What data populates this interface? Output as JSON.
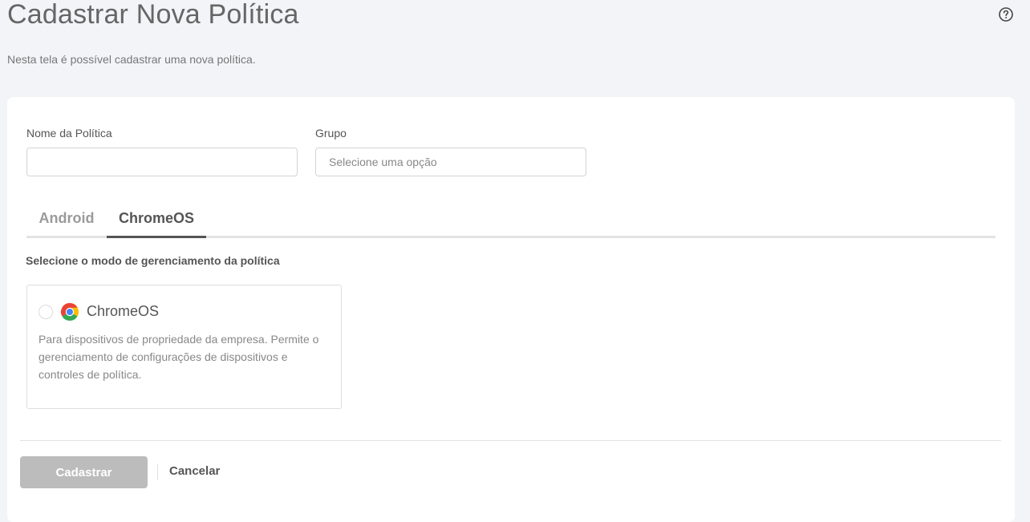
{
  "header": {
    "title": "Cadastrar Nova Política",
    "subtitle": "Nesta tela é possível cadastrar uma nova política.",
    "help_icon": "question-circle-icon"
  },
  "form": {
    "name_label": "Nome da Política",
    "name_value": "",
    "group_label": "Grupo",
    "group_placeholder": "Selecione uma opção"
  },
  "tabs": [
    {
      "label": "Android",
      "active": false
    },
    {
      "label": "ChromeOS",
      "active": true
    }
  ],
  "management": {
    "section_label": "Selecione o modo de gerenciamento da política",
    "options": [
      {
        "icon": "chrome-icon",
        "title": "ChromeOS",
        "description": "Para dispositivos de propriedade da empresa. Permite o gerenciamento de configurações de dispositivos e controles de política.",
        "selected": false
      }
    ]
  },
  "actions": {
    "submit_label": "Cadastrar",
    "cancel_label": "Cancelar"
  }
}
